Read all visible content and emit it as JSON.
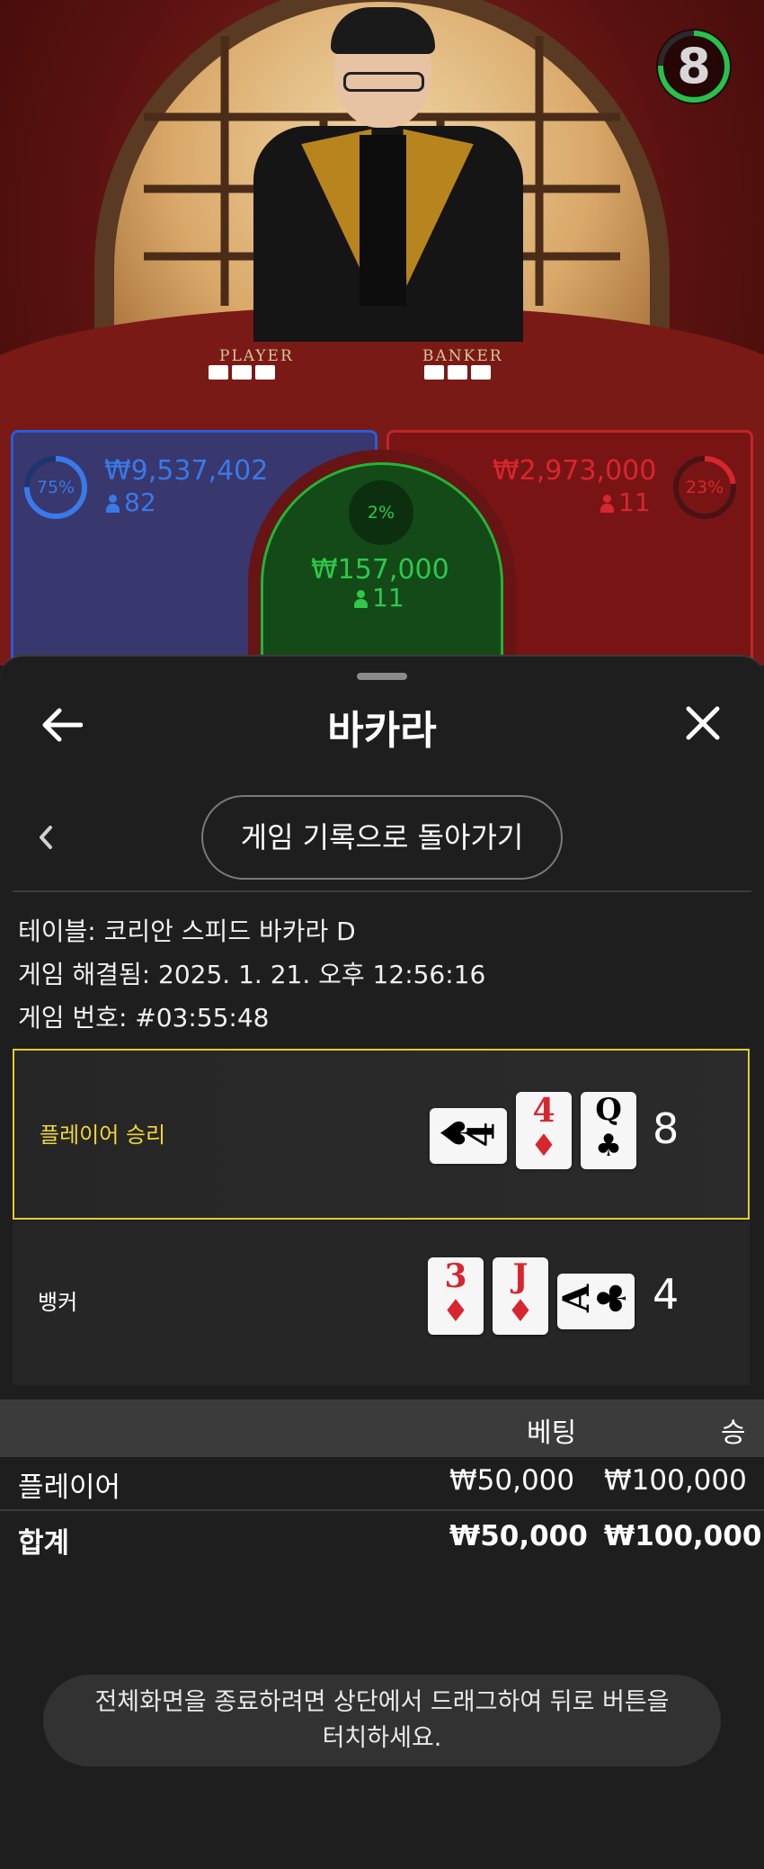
{
  "video": {
    "timer": "8",
    "table_labels": {
      "player": "PLAYER",
      "banker": "BANKER"
    },
    "bets": {
      "player": {
        "percent": "75%",
        "amount": "₩9,537,402",
        "count": "82",
        "color": "#3a79e8"
      },
      "tie": {
        "percent": "2%",
        "amount": "₩157,000",
        "count": "11",
        "color": "#2fc84a"
      },
      "banker": {
        "percent": "23%",
        "amount": "₩2,973,000",
        "count": "11",
        "color": "#d8262e"
      }
    }
  },
  "sheet": {
    "title": "바카라",
    "back_icon": "arrow-left-icon",
    "close_icon": "close-icon",
    "nav_button": "게임 기록으로 돌아가기",
    "info": {
      "table": "테이블: 코리안 스피드 바카라 D",
      "resolved": "게임 해결됨: 2025. 1. 21. 오후 12:56:16",
      "game_id": "게임 번호: #03:55:48"
    },
    "rounds": [
      {
        "label": "플레이어 승리",
        "label_color": "#f1d63a",
        "winner": true,
        "score": "8",
        "cards": [
          {
            "rank": "4",
            "suit": "♠",
            "color": "#000000",
            "sideways": true
          },
          {
            "rank": "4",
            "suit": "♦",
            "color": "#d8262e",
            "sideways": false
          },
          {
            "rank": "Q",
            "suit": "♣",
            "color": "#000000",
            "sideways": false
          }
        ]
      },
      {
        "label": "뱅커",
        "label_color": "#ffffff",
        "winner": false,
        "score": "4",
        "cards": [
          {
            "rank": "3",
            "suit": "♦",
            "color": "#d8262e",
            "sideways": false
          },
          {
            "rank": "J",
            "suit": "♦",
            "color": "#d8262e",
            "sideways": false
          },
          {
            "rank": "A",
            "suit": "♣",
            "color": "#000000",
            "sideways": true
          }
        ]
      }
    ],
    "bet_table": {
      "headers": {
        "bet": "베팅",
        "win": "승"
      },
      "rows": [
        {
          "name": "플레이어",
          "bet": "₩50,000",
          "win": "₩100,000"
        }
      ],
      "total": {
        "name": "합계",
        "bet": "₩50,000",
        "win": "₩100,000"
      }
    },
    "toast": {
      "line1": "전체화면을 종료하려면 상단에서 드래그하여 뒤로 버튼을",
      "line2": "터치하세요."
    }
  }
}
